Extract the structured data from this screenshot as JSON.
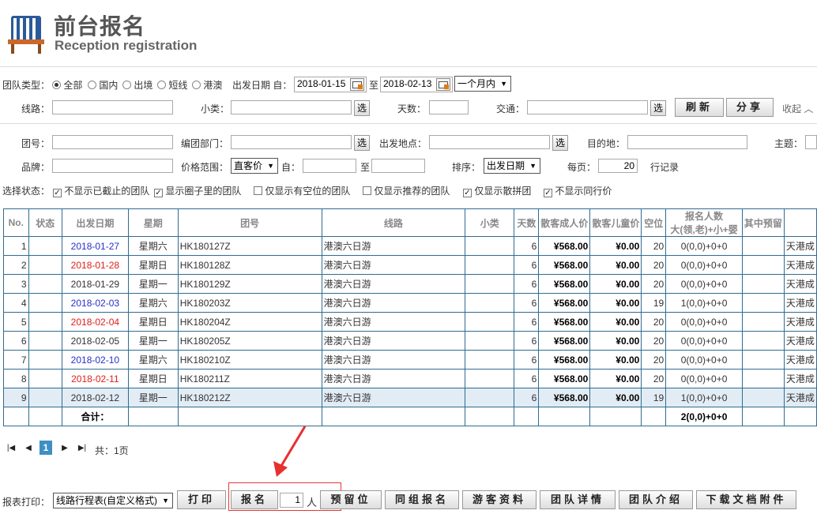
{
  "header": {
    "title_zh": "前台报名",
    "title_en": "Reception registration"
  },
  "filter": {
    "tour_type_label": "团队类型：",
    "tour_types": [
      "全部",
      "国内",
      "出境",
      "短线",
      "港澳"
    ],
    "tour_type_selected": "全部",
    "depart_date_label": "出发日期 自：",
    "date_from": "2018-01-15",
    "to_label": "至",
    "date_to": "2018-02-13",
    "range_select": "一个月内",
    "route_label": "线路：",
    "route_value": "",
    "subtype_label": "小类：",
    "subtype_value": "",
    "select_btn": "选",
    "days_label": "天数：",
    "days_value": "",
    "traffic_label": "交通：",
    "traffic_value": "",
    "refresh_btn": "刷新",
    "share_btn": "分享",
    "collapse_label": "收起",
    "group_no_label": "团号：",
    "dept_label": "编团部门：",
    "depart_place_label": "出发地点：",
    "dest_label": "目的地：",
    "theme_label": "主题：",
    "brand_label": "品牌：",
    "price_range_label": "价格范围：",
    "price_type": "直客价",
    "price_from_label": "自：",
    "price_to_label": "至",
    "sort_label": "排序：",
    "sort_value": "出发日期",
    "per_page_label": "每页：",
    "per_page_value": "20",
    "records_label": "行记录",
    "state_label": "选择状态：",
    "checks": [
      {
        "label": "不显示已截止的团队",
        "checked": true
      },
      {
        "label": "显示圈子里的团队",
        "checked": true
      },
      {
        "label": "仅显示有空位的团队",
        "checked": false
      },
      {
        "label": "仅显示推荐的团队",
        "checked": false
      },
      {
        "label": "仅显示散拼团",
        "checked": true
      },
      {
        "label": "不显示同行价",
        "checked": true
      }
    ]
  },
  "table": {
    "headers": [
      "No.",
      "状态",
      "出发日期",
      "星期",
      "团号",
      "线路",
      "小类",
      "天数",
      "散客成人价",
      "散客儿童价",
      "空位",
      "报名人数",
      "大(领,老)+小+婴",
      "其中预留",
      ""
    ],
    "rows": [
      {
        "no": "1",
        "status": "",
        "date": "2018-01-27",
        "color": "blue",
        "week": "星期六",
        "group": "HK180127Z",
        "route": "港澳六日游",
        "sub": "",
        "days": "6",
        "adult": "¥568.00",
        "child": "¥0.00",
        "seats": "20",
        "enroll": "0(0,0)+0+0",
        "reserve": "",
        "extra": "天港成"
      },
      {
        "no": "2",
        "status": "",
        "date": "2018-01-28",
        "color": "red",
        "week": "星期日",
        "group": "HK180128Z",
        "route": "港澳六日游",
        "sub": "",
        "days": "6",
        "adult": "¥568.00",
        "child": "¥0.00",
        "seats": "20",
        "enroll": "0(0,0)+0+0",
        "reserve": "",
        "extra": "天港成"
      },
      {
        "no": "3",
        "status": "",
        "date": "2018-01-29",
        "color": "",
        "week": "星期一",
        "group": "HK180129Z",
        "route": "港澳六日游",
        "sub": "",
        "days": "6",
        "adult": "¥568.00",
        "child": "¥0.00",
        "seats": "20",
        "enroll": "0(0,0)+0+0",
        "reserve": "",
        "extra": "天港成"
      },
      {
        "no": "4",
        "status": "",
        "date": "2018-02-03",
        "color": "blue",
        "week": "星期六",
        "group": "HK180203Z",
        "route": "港澳六日游",
        "sub": "",
        "days": "6",
        "adult": "¥568.00",
        "child": "¥0.00",
        "seats": "19",
        "enroll": "1(0,0)+0+0",
        "reserve": "",
        "extra": "天港成"
      },
      {
        "no": "5",
        "status": "",
        "date": "2018-02-04",
        "color": "red",
        "week": "星期日",
        "group": "HK180204Z",
        "route": "港澳六日游",
        "sub": "",
        "days": "6",
        "adult": "¥568.00",
        "child": "¥0.00",
        "seats": "20",
        "enroll": "0(0,0)+0+0",
        "reserve": "",
        "extra": "天港成"
      },
      {
        "no": "6",
        "status": "",
        "date": "2018-02-05",
        "color": "",
        "week": "星期一",
        "group": "HK180205Z",
        "route": "港澳六日游",
        "sub": "",
        "days": "6",
        "adult": "¥568.00",
        "child": "¥0.00",
        "seats": "20",
        "enroll": "0(0,0)+0+0",
        "reserve": "",
        "extra": "天港成"
      },
      {
        "no": "7",
        "status": "",
        "date": "2018-02-10",
        "color": "blue",
        "week": "星期六",
        "group": "HK180210Z",
        "route": "港澳六日游",
        "sub": "",
        "days": "6",
        "adult": "¥568.00",
        "child": "¥0.00",
        "seats": "20",
        "enroll": "0(0,0)+0+0",
        "reserve": "",
        "extra": "天港成"
      },
      {
        "no": "8",
        "status": "",
        "date": "2018-02-11",
        "color": "red",
        "week": "星期日",
        "group": "HK180211Z",
        "route": "港澳六日游",
        "sub": "",
        "days": "6",
        "adult": "¥568.00",
        "child": "¥0.00",
        "seats": "20",
        "enroll": "0(0,0)+0+0",
        "reserve": "",
        "extra": "天港成"
      },
      {
        "no": "9",
        "status": "",
        "date": "2018-02-12",
        "color": "",
        "week": "星期一",
        "group": "HK180212Z",
        "route": "港澳六日游",
        "sub": "",
        "days": "6",
        "adult": "¥568.00",
        "child": "¥0.00",
        "seats": "19",
        "enroll": "1(0,0)+0+0",
        "reserve": "",
        "extra": "天港成"
      }
    ],
    "total_label": "合计：",
    "total_enroll": "2(0,0)+0+0"
  },
  "pager": {
    "current": "1",
    "summary": "共：1页"
  },
  "bottom": {
    "print_label": "报表打印：",
    "print_select": "线路行程表(自定义格式)",
    "print_btn": "打印",
    "enroll_btn": "报名",
    "people_count": "1",
    "people_unit": "人",
    "reserve_btn": "预留位",
    "same_group_btn": "同组报名",
    "tourist_btn": "游客资料",
    "detail_btn": "团队详情",
    "intro_btn": "团队介绍",
    "download_btn": "下载文档附件"
  }
}
